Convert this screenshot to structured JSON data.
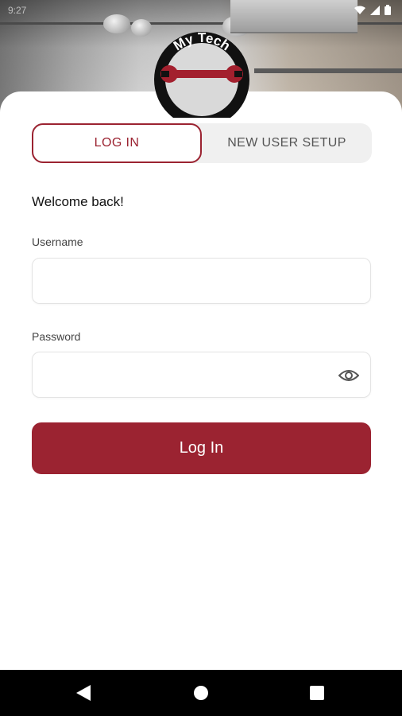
{
  "status_bar": {
    "time": "9:27",
    "icons": [
      "wifi-icon",
      "signal-icon",
      "battery-icon"
    ]
  },
  "logo": {
    "text": "My Tech",
    "icon": "wrench-icon"
  },
  "tabs": [
    {
      "label": "LOG IN",
      "active": true
    },
    {
      "label": "NEW USER SETUP",
      "active": false
    }
  ],
  "form": {
    "welcome": "Welcome back!",
    "username_label": "Username",
    "username_value": "",
    "password_label": "Password",
    "password_value": "",
    "password_toggle_icon": "eye-icon",
    "submit_label": "Log In"
  },
  "navbar": {
    "icons": [
      "back-triangle-icon",
      "home-circle-icon",
      "recents-square-icon"
    ]
  },
  "colors": {
    "accent": "#9b2331",
    "tab_track": "#f0f0f0",
    "navbar": "#000000"
  }
}
